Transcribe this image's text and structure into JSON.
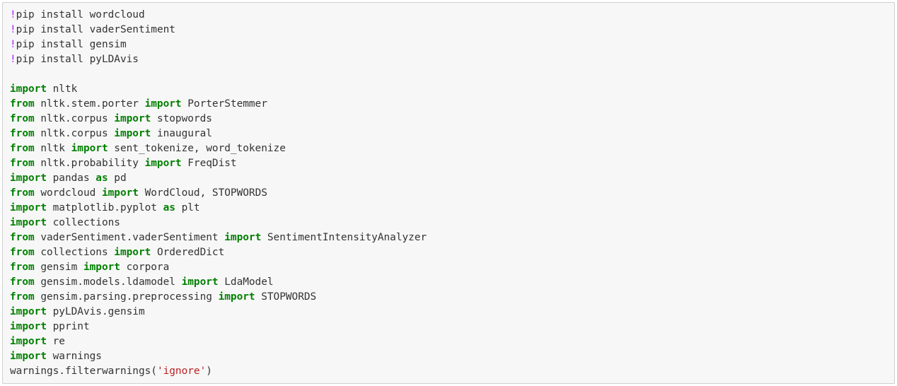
{
  "cell": {
    "lines": [
      [
        {
          "t": "bang",
          "v": "!"
        },
        {
          "t": "plain",
          "v": "pip install wordcloud"
        }
      ],
      [
        {
          "t": "bang",
          "v": "!"
        },
        {
          "t": "plain",
          "v": "pip install vaderSentiment"
        }
      ],
      [
        {
          "t": "bang",
          "v": "!"
        },
        {
          "t": "plain",
          "v": "pip install gensim"
        }
      ],
      [
        {
          "t": "bang",
          "v": "!"
        },
        {
          "t": "plain",
          "v": "pip install pyLDAvis"
        }
      ],
      [],
      [
        {
          "t": "kw",
          "v": "import"
        },
        {
          "t": "plain",
          "v": " nltk"
        }
      ],
      [
        {
          "t": "kw",
          "v": "from"
        },
        {
          "t": "plain",
          "v": " nltk.stem.porter "
        },
        {
          "t": "kw",
          "v": "import"
        },
        {
          "t": "plain",
          "v": " PorterStemmer"
        }
      ],
      [
        {
          "t": "kw",
          "v": "from"
        },
        {
          "t": "plain",
          "v": " nltk.corpus "
        },
        {
          "t": "kw",
          "v": "import"
        },
        {
          "t": "plain",
          "v": " stopwords"
        }
      ],
      [
        {
          "t": "kw",
          "v": "from"
        },
        {
          "t": "plain",
          "v": " nltk.corpus "
        },
        {
          "t": "kw",
          "v": "import"
        },
        {
          "t": "plain",
          "v": " inaugural"
        }
      ],
      [
        {
          "t": "kw",
          "v": "from"
        },
        {
          "t": "plain",
          "v": " nltk "
        },
        {
          "t": "kw",
          "v": "import"
        },
        {
          "t": "plain",
          "v": " sent_tokenize, word_tokenize"
        }
      ],
      [
        {
          "t": "kw",
          "v": "from"
        },
        {
          "t": "plain",
          "v": " nltk.probability "
        },
        {
          "t": "kw",
          "v": "import"
        },
        {
          "t": "plain",
          "v": " FreqDist"
        }
      ],
      [
        {
          "t": "kw",
          "v": "import"
        },
        {
          "t": "plain",
          "v": " pandas "
        },
        {
          "t": "kw",
          "v": "as"
        },
        {
          "t": "plain",
          "v": " pd"
        }
      ],
      [
        {
          "t": "kw",
          "v": "from"
        },
        {
          "t": "plain",
          "v": " wordcloud "
        },
        {
          "t": "kw",
          "v": "import"
        },
        {
          "t": "plain",
          "v": " WordCloud, STOPWORDS"
        }
      ],
      [
        {
          "t": "kw",
          "v": "import"
        },
        {
          "t": "plain",
          "v": " matplotlib.pyplot "
        },
        {
          "t": "kw",
          "v": "as"
        },
        {
          "t": "plain",
          "v": " plt"
        }
      ],
      [
        {
          "t": "kw",
          "v": "import"
        },
        {
          "t": "plain",
          "v": " collections"
        }
      ],
      [
        {
          "t": "kw",
          "v": "from"
        },
        {
          "t": "plain",
          "v": " vaderSentiment.vaderSentiment "
        },
        {
          "t": "kw",
          "v": "import"
        },
        {
          "t": "plain",
          "v": " SentimentIntensityAnalyzer"
        }
      ],
      [
        {
          "t": "kw",
          "v": "from"
        },
        {
          "t": "plain",
          "v": " collections "
        },
        {
          "t": "kw",
          "v": "import"
        },
        {
          "t": "plain",
          "v": " OrderedDict"
        }
      ],
      [
        {
          "t": "kw",
          "v": "from"
        },
        {
          "t": "plain",
          "v": " gensim "
        },
        {
          "t": "kw",
          "v": "import"
        },
        {
          "t": "plain",
          "v": " corpora"
        }
      ],
      [
        {
          "t": "kw",
          "v": "from"
        },
        {
          "t": "plain",
          "v": " gensim.models.ldamodel "
        },
        {
          "t": "kw",
          "v": "import"
        },
        {
          "t": "plain",
          "v": " LdaModel"
        }
      ],
      [
        {
          "t": "kw",
          "v": "from"
        },
        {
          "t": "plain",
          "v": " gensim.parsing.preprocessing "
        },
        {
          "t": "kw",
          "v": "import"
        },
        {
          "t": "plain",
          "v": " STOPWORDS"
        }
      ],
      [
        {
          "t": "kw",
          "v": "import"
        },
        {
          "t": "plain",
          "v": " pyLDAvis.gensim"
        }
      ],
      [
        {
          "t": "kw",
          "v": "import"
        },
        {
          "t": "plain",
          "v": " pprint"
        }
      ],
      [
        {
          "t": "kw",
          "v": "import"
        },
        {
          "t": "plain",
          "v": " re"
        }
      ],
      [
        {
          "t": "kw",
          "v": "import"
        },
        {
          "t": "plain",
          "v": " warnings"
        }
      ],
      [
        {
          "t": "plain",
          "v": "warnings.filterwarnings("
        },
        {
          "t": "str",
          "v": "'ignore'"
        },
        {
          "t": "plain",
          "v": ")"
        }
      ]
    ]
  },
  "colors": {
    "keyword": "#008000",
    "shell_bang": "#aa22ff",
    "string": "#ba2121",
    "text": "#333333",
    "cell_background": "#f7f7f7",
    "cell_border": "#cfcfcf"
  }
}
